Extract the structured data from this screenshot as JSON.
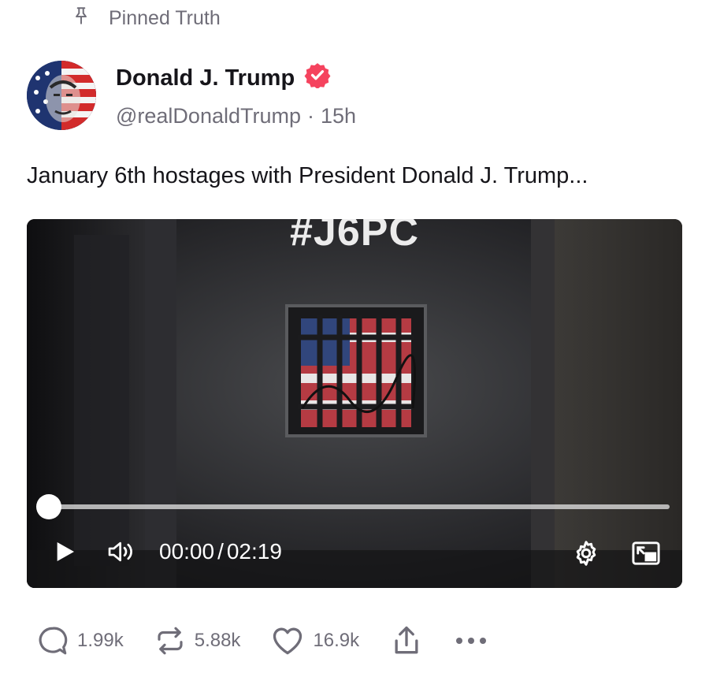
{
  "pinned": {
    "label": "Pinned Truth",
    "icon": "pin-icon"
  },
  "author": {
    "name": "Donald J. Trump",
    "verified_icon": "verified-badge-icon",
    "verified_color": "#f5435e",
    "handle": "@realDonaldTrump",
    "separator": "·",
    "time": "15h"
  },
  "post": {
    "text": "January 6th hostages with President Donald J. Trump..."
  },
  "video": {
    "overlay_text": "#J6PC",
    "current_time": "00:00",
    "time_separator": "/",
    "duration": "02:19",
    "progress": 0,
    "controls": [
      "play-icon",
      "volume-icon",
      "settings-gear-icon",
      "picture-in-picture-icon"
    ]
  },
  "actions": {
    "replies": "1.99k",
    "retruths": "5.88k",
    "likes": "16.9k"
  },
  "colors": {
    "text": "#16151a",
    "muted": "#6f6d78",
    "accent": "#f5435e"
  }
}
